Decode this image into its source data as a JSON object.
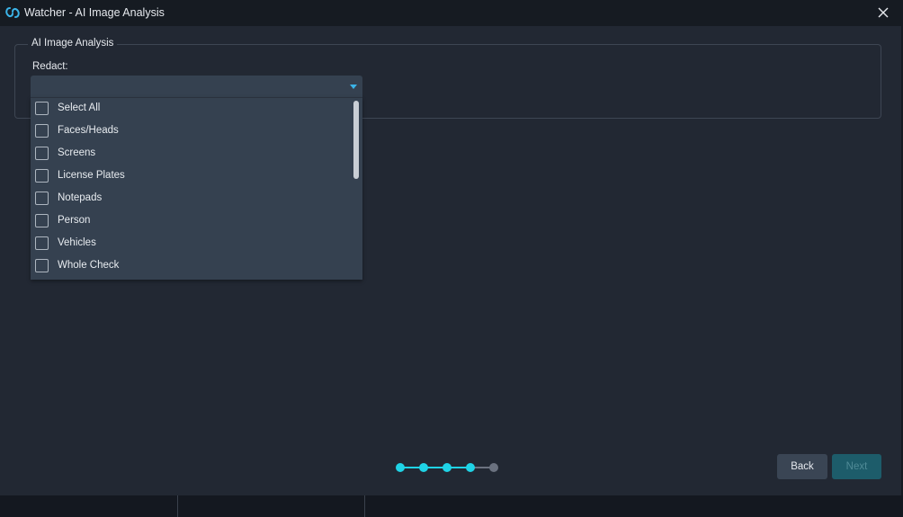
{
  "window": {
    "title": "Watcher - AI Image Analysis",
    "app_icon": "watcher-logo-icon",
    "close_icon": "close-icon"
  },
  "section": {
    "legend": "AI Image Analysis"
  },
  "redact": {
    "label": "Redact:",
    "selected_value": "",
    "options": [
      {
        "label": "Select All",
        "checked": false
      },
      {
        "label": "Faces/Heads",
        "checked": false
      },
      {
        "label": "Screens",
        "checked": false
      },
      {
        "label": "License Plates",
        "checked": false
      },
      {
        "label": "Notepads",
        "checked": false
      },
      {
        "label": "Person",
        "checked": false
      },
      {
        "label": "Vehicles",
        "checked": false
      },
      {
        "label": "Whole Check",
        "checked": false
      }
    ]
  },
  "wizard": {
    "total_steps": 5,
    "completed_steps": 4,
    "active_color": "#1fd3e6",
    "inactive_color": "#6b7280"
  },
  "buttons": {
    "back_label": "Back",
    "next_label": "Next"
  },
  "colors": {
    "accent": "#3bb4e8",
    "next_button_bg": "#1d5c6a"
  }
}
